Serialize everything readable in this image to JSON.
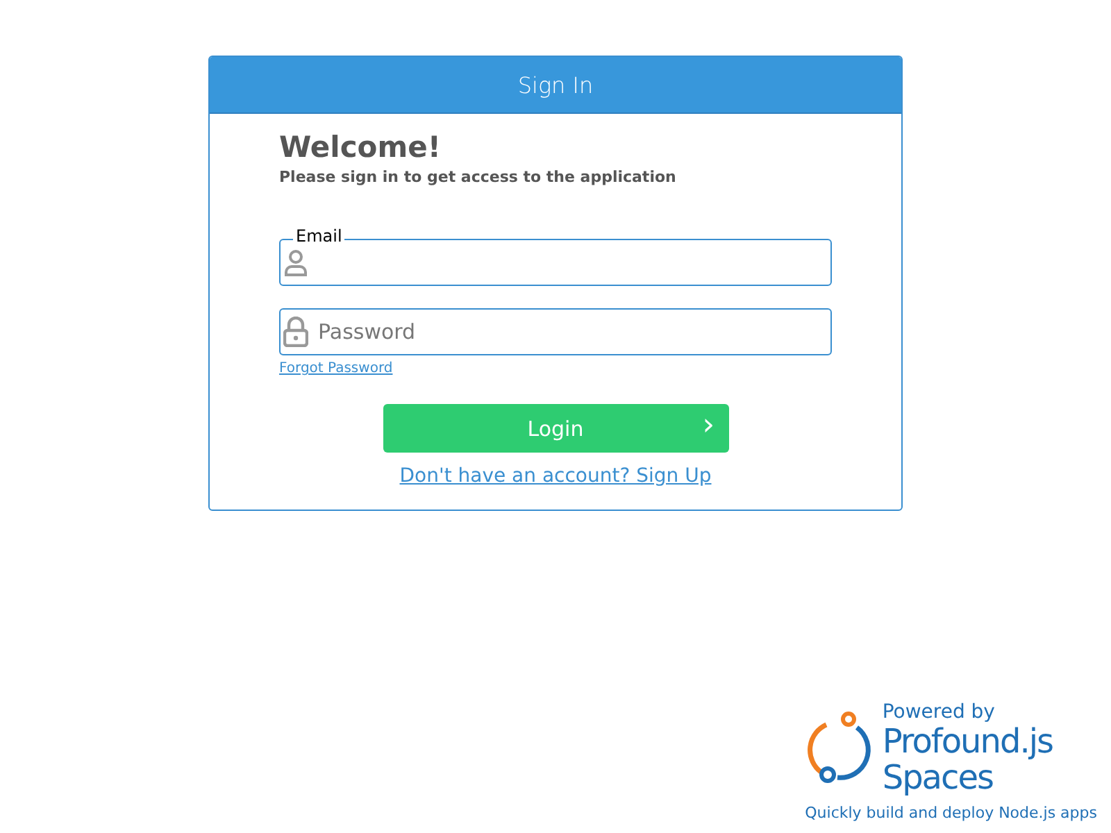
{
  "card": {
    "title": "Sign In",
    "heading": "Welcome!",
    "subheading": "Please sign in to get access to the application",
    "fields": [
      {
        "kind": "email",
        "label": "Email"
      },
      {
        "kind": "password",
        "placeholder": "Password"
      }
    ],
    "forgot_link": "Forgot Password",
    "login_button": "Login",
    "login_arrow": "›",
    "signup_link": "Don't have an account? Sign Up"
  },
  "branding": {
    "powered_by": "Powered by",
    "product_line_1": "Profound.js",
    "product_line_2": "Spaces",
    "tagline": "Quickly build and deploy Node.js apps"
  }
}
